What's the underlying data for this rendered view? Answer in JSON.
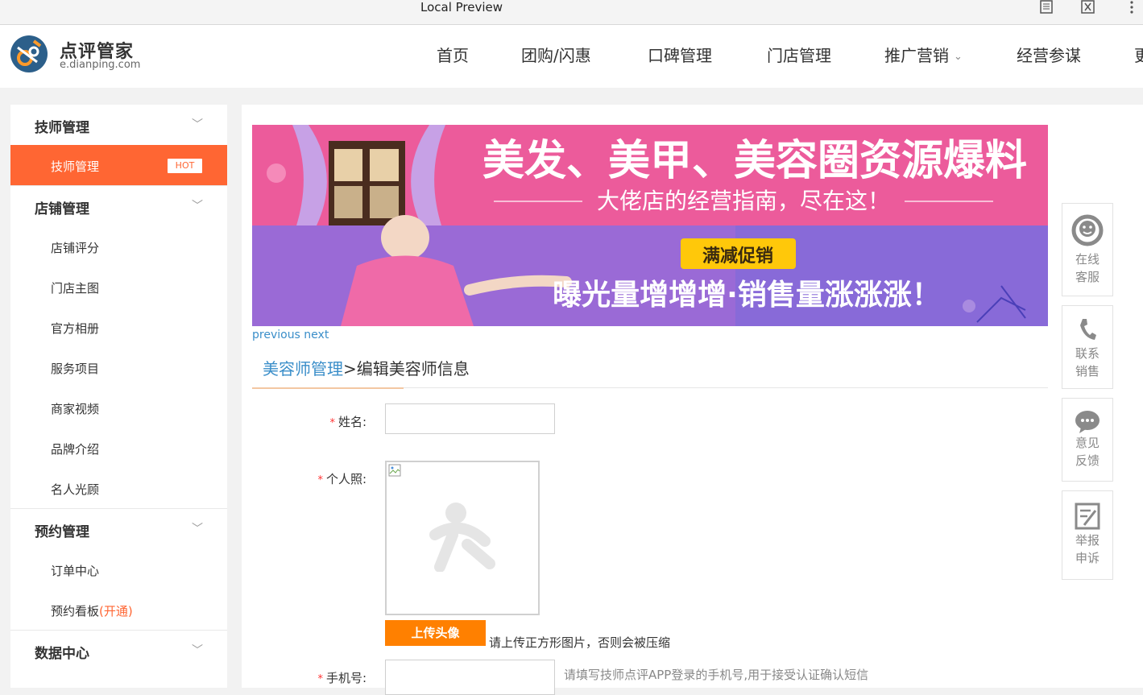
{
  "window": {
    "title": "Local Preview"
  },
  "header": {
    "brand": "点评管家",
    "domain": "e.dianping.com",
    "nav": [
      "首页",
      "团购/闪惠",
      "口碑管理",
      "门店管理",
      "推广营销",
      "经营参谋",
      "更"
    ]
  },
  "sidebar": {
    "sections": [
      {
        "title": "技师管理",
        "items": [
          {
            "label": "技师管理",
            "badge": "HOT",
            "active": true
          }
        ]
      },
      {
        "title": "店铺管理",
        "items": [
          {
            "label": "店铺评分"
          },
          {
            "label": "门店主图"
          },
          {
            "label": "官方相册"
          },
          {
            "label": "服务项目"
          },
          {
            "label": "商家视频"
          },
          {
            "label": "品牌介绍"
          },
          {
            "label": "名人光顾"
          }
        ]
      },
      {
        "title": "预约管理",
        "items": [
          {
            "label": "订单中心"
          },
          {
            "label": "预约看板",
            "extra": "(开通)"
          }
        ]
      },
      {
        "title": "数据中心",
        "items": []
      }
    ]
  },
  "banner": {
    "headline": "美发、美甲、美容圈资源爆料",
    "subline": "大佬店的经营指南，尽在这！",
    "tag": "满减促销",
    "slogan": "曝光量增增增·销售量涨涨涨！",
    "pager": "previous next"
  },
  "breadcrumb": {
    "parent": "美容师管理",
    "separator": ">",
    "current": "编辑美容师信息"
  },
  "form": {
    "required_mark": "*",
    "name_label": "姓名:",
    "name_value": "",
    "photo_label": "个人照:",
    "upload_button": "上传头像",
    "upload_hint": "请上传正方形图片，否则会被压缩",
    "phone_label": "手机号:",
    "phone_value": "",
    "phone_hint": "请填写技师点评APP登录的手机号,用于接受认证确认短信"
  },
  "float_bar": [
    {
      "icon": "customer-service-icon",
      "line1": "在线",
      "line2": "客服"
    },
    {
      "icon": "phone-icon",
      "line1": "联系",
      "line2": "销售"
    },
    {
      "icon": "chat-bubble-icon",
      "line1": "意见",
      "line2": "反馈"
    },
    {
      "icon": "report-icon",
      "line1": "举报",
      "line2": "申诉"
    }
  ],
  "colors": {
    "accent": "#ff6633",
    "link": "#3a8ec9",
    "upload": "#ff8000",
    "banner_pink": "#ec5b9b",
    "banner_purple": "#9a6ad6"
  }
}
